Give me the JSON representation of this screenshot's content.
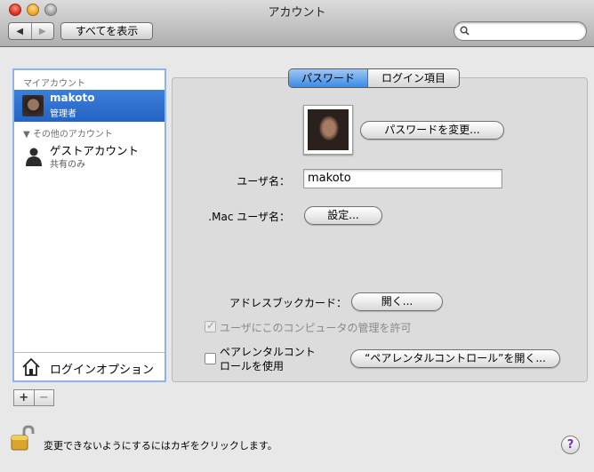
{
  "window": {
    "title": "アカウント"
  },
  "toolbar": {
    "back": "◀",
    "forward": "▶",
    "show_all": "すべてを表示",
    "search_value": ""
  },
  "sidebar": {
    "my_account_header": "マイアカウント",
    "current_user": {
      "name": "makoto",
      "role": "管理者"
    },
    "other_header": "▼ その他のアカウント",
    "guest": {
      "name": "ゲストアカウント",
      "role": "共有のみ"
    },
    "login_options": "ログインオプション",
    "add": "+",
    "remove": "−"
  },
  "tabs": [
    {
      "label": "パスワード"
    },
    {
      "label": "ログイン項目"
    }
  ],
  "password": {
    "change_password_button": "パスワードを変更...",
    "username_label": "ユーザ名：",
    "username_value": "makoto",
    "mac_label": ".Mac ユーザ名：",
    "mac_button": "設定...",
    "addressbook_label": "アドレスブックカード：",
    "open_button": "開く...",
    "admin_checkbox": "ユーザにこのコンピュータの管理を許可",
    "parental_checkbox_line1": "ペアレンタルコント",
    "parental_checkbox_line2": "ロールを使用",
    "parental_button": "“ペアレンタルコントロール”を開く..."
  },
  "footer": {
    "lock_text": "変更できないようにするにはカギをクリックします。",
    "help": "?"
  },
  "colors": {
    "selection": "#2a6bcc",
    "panel": "#dcdcdc",
    "tab_active": "#5b9ff0"
  }
}
